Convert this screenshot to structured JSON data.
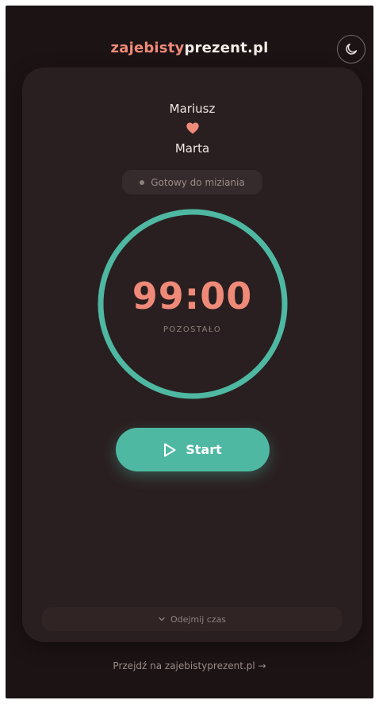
{
  "header": {
    "brand_part1": "zajebisty",
    "brand_part2": "prezent.pl",
    "theme_toggle_icon": "moon-icon"
  },
  "card": {
    "name_top": "Mariusz",
    "heart_icon": "heart-icon",
    "name_bottom": "Marta",
    "status_text": "Gotowy do miziania",
    "timer_value": "99:00",
    "timer_label": "POZOSTAŁO",
    "start_label": "Start",
    "start_icon": "play-icon",
    "subtract_label": "Odejmij czas",
    "subtract_icon": "chevron-down-icon"
  },
  "footer": {
    "link_text": "Przejdź na zajebistyprezent.pl →"
  },
  "colors": {
    "background": "#1c1314",
    "card": "#2a1f20",
    "accent_salmon": "#ef8a79",
    "accent_teal": "#4eb8a2",
    "muted_text": "#8e807d"
  }
}
